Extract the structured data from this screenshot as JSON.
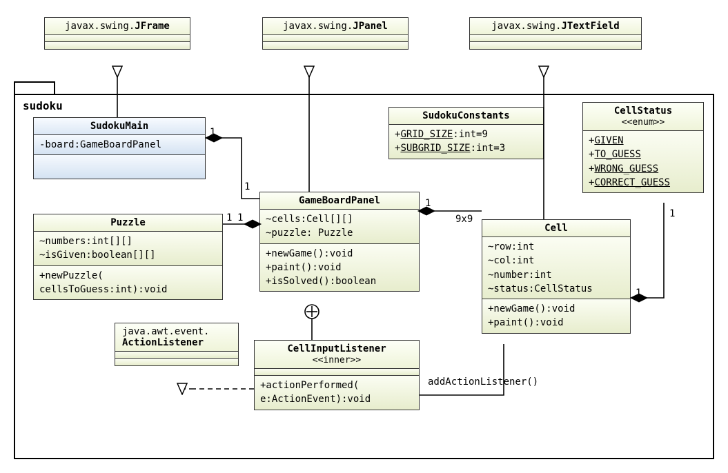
{
  "package": {
    "name": "sudoku"
  },
  "classes": {
    "jframe": {
      "pkg": "javax.swing.",
      "name": "JFrame"
    },
    "jpanel": {
      "pkg": "javax.swing.",
      "name": "JPanel"
    },
    "jtextfield": {
      "pkg": "javax.swing.",
      "name": "JTextField"
    },
    "actionlistener": {
      "pkg": "java.awt.event.",
      "name": "ActionListener"
    },
    "sudokumain": {
      "name": "SudokuMain",
      "attrs": [
        "-board:GameBoardPanel"
      ]
    },
    "sudokuconstants": {
      "name": "SudokuConstants",
      "attrs_static": [
        "+GRID_SIZE:int=9",
        "+SUBGRID_SIZE:int=3"
      ]
    },
    "cellstatus": {
      "name": "CellStatus",
      "stereo": "<<enum>>",
      "values": [
        "+GIVEN",
        "+TO_GUESS",
        "+WRONG_GUESS",
        "+CORRECT_GUESS"
      ]
    },
    "puzzle": {
      "name": "Puzzle",
      "attrs": [
        "~numbers:int[][]",
        "~isGiven:boolean[][]"
      ],
      "ops": [
        "+newPuzzle(",
        "  cellsToGuess:int):void"
      ]
    },
    "gameboardpanel": {
      "name": "GameBoardPanel",
      "attrs": [
        "~cells:Cell[][]",
        "~puzzle: Puzzle"
      ],
      "ops": [
        "+newGame():void",
        "+paint():void",
        "+isSolved():boolean"
      ]
    },
    "cell": {
      "name": "Cell",
      "attrs": [
        "~row:int",
        "~col:int",
        "~number:int",
        "~status:CellStatus"
      ],
      "ops": [
        "+newGame():void",
        "+paint():void"
      ]
    },
    "cellinputlistener": {
      "name": "CellInputListener",
      "stereo": "<<inner>>",
      "ops": [
        "+actionPerformed(",
        "  e:ActionEvent):void"
      ]
    }
  },
  "edge_labels": {
    "sm_gbp_1a": "1",
    "sm_gbp_1b": "1",
    "gbp_puzzle_1a": "1",
    "gbp_puzzle_1b": "1",
    "gbp_cell_1": "1",
    "gbp_cell_9x9": "9x9",
    "cell_status_1a": "1",
    "cell_status_1b": "1",
    "addAction": "addActionListener()"
  }
}
